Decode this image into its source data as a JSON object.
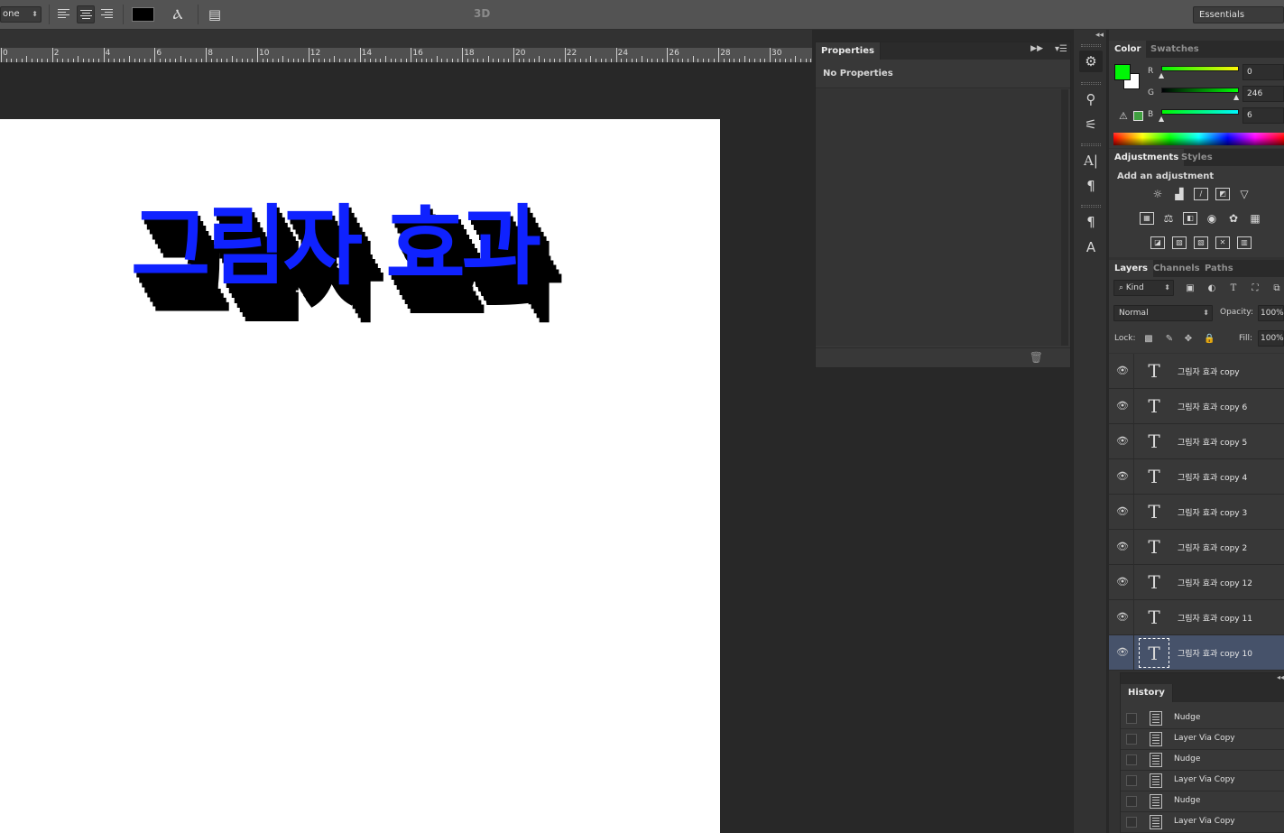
{
  "options_bar": {
    "font_size_dropdown": "one",
    "align_buttons": [
      "align-left",
      "align-center",
      "align-right"
    ],
    "text_color": "#000000",
    "mode_3d_label": "3D",
    "workspace": "Essentials"
  },
  "ruler": {
    "labels": [
      "0",
      "2",
      "4",
      "6",
      "8",
      "10",
      "12",
      "14",
      "16",
      "18",
      "20",
      "22",
      "24",
      "26",
      "28",
      "30"
    ]
  },
  "canvas": {
    "text": "그림자 효과",
    "text_color": "#0f22ff",
    "shadow_color": "#000000",
    "background": "#ffffff"
  },
  "properties_panel": {
    "tab": "Properties",
    "empty_message": "No Properties"
  },
  "color_panel": {
    "tabs": [
      "Color",
      "Swatches"
    ],
    "foreground": "#00f606",
    "background": "#ffffff",
    "channels": [
      {
        "label": "R",
        "value": "0"
      },
      {
        "label": "G",
        "value": "246"
      },
      {
        "label": "B",
        "value": "6"
      }
    ]
  },
  "adjustments_panel": {
    "tabs": [
      "Adjustments",
      "Styles"
    ],
    "heading": "Add an adjustment"
  },
  "layers_panel": {
    "tabs": [
      "Layers",
      "Channels",
      "Paths"
    ],
    "filter_kind": "Kind",
    "blend_mode": "Normal",
    "opacity_label": "Opacity:",
    "opacity_value": "100%",
    "lock_label": "Lock:",
    "fill_label": "Fill:",
    "fill_value": "100%",
    "layers": [
      {
        "name": "그림자 효과 copy",
        "selected": false
      },
      {
        "name": "그림자 효과 copy 6",
        "selected": false
      },
      {
        "name": "그림자 효과 copy 5",
        "selected": false
      },
      {
        "name": "그림자 효과 copy 4",
        "selected": false
      },
      {
        "name": "그림자 효과 copy 3",
        "selected": false
      },
      {
        "name": "그림자 효과 copy 2",
        "selected": false
      },
      {
        "name": "그림자 효과 copy 12",
        "selected": false
      },
      {
        "name": "그림자 효과 copy 11",
        "selected": false
      },
      {
        "name": "그림자 효과 copy 10",
        "selected": true
      }
    ]
  },
  "history_panel": {
    "tab": "History",
    "items": [
      "Nudge",
      "Layer Via Copy",
      "Nudge",
      "Layer Via Copy",
      "Nudge",
      "Layer Via Copy"
    ]
  }
}
